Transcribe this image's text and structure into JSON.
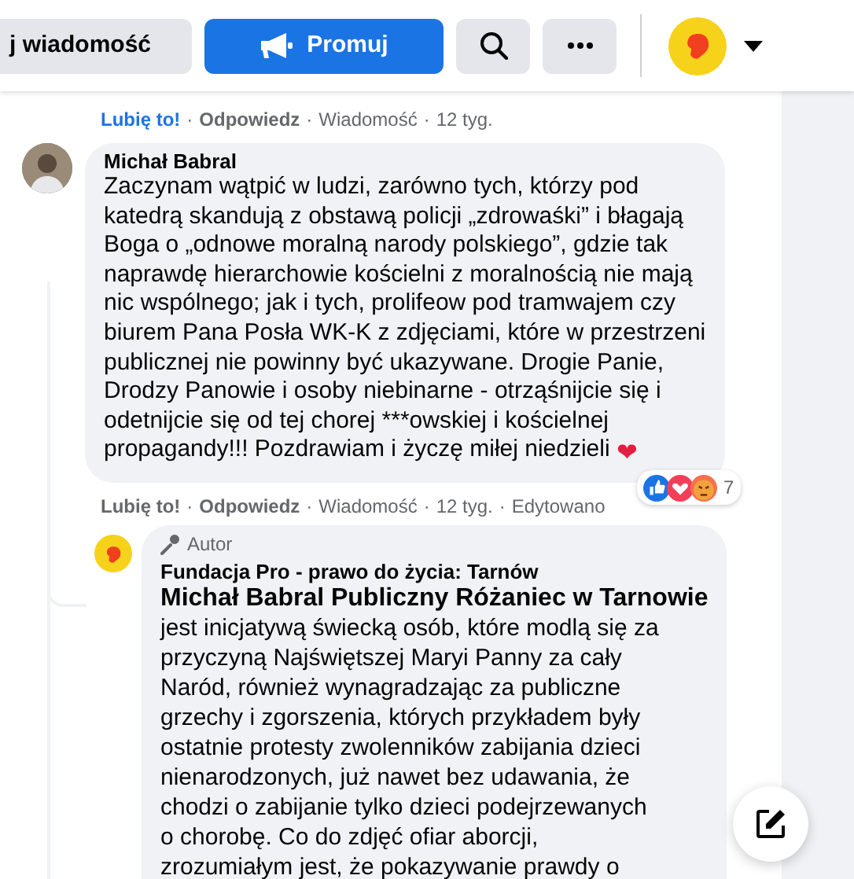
{
  "header": {
    "message_button": "j wiadomość",
    "promote_button": "Promuj"
  },
  "previous_actions": {
    "liked": true,
    "separator": "·",
    "items": [
      {
        "kind": "like",
        "text": "Lubię to!"
      },
      {
        "kind": "reply",
        "text": "Odpowiedz"
      },
      {
        "kind": "meta",
        "text": "Wiadomość"
      },
      {
        "kind": "meta",
        "text": "12 tyg."
      }
    ]
  },
  "comment": {
    "author": "Michał Babral",
    "lines": [
      "Zaczynam wątpić w ludzi, zarówno tych, którzy pod",
      "katedrą skandują z obstawą policji „zdrowaśki” i błagają",
      "Boga o „odnowe moralną narody polskiego”, gdzie tak",
      "naprawdę hierarchowie kościelni z moralnością nie mają",
      "nic wspólnego; jak i tych, prolifeow pod tramwajem czy",
      "biurem Pana Posła WK-K z zdjęciami, które w przestrzeni",
      "publicznej nie powinny być ukazywane. Drogie Panie,",
      "Drodzy Panowie i osoby niebinarne - otrząśnijcie się i",
      "odetnijcie się od tej chorej ***owskiej i kościelnej",
      "propagandy!!! Pozdrawiam i życzę miłej niedzieli"
    ],
    "emoji": "❤",
    "reactions": {
      "types": [
        {
          "kind": "like"
        },
        {
          "kind": "love"
        },
        {
          "kind": "angry"
        }
      ],
      "count": "7"
    },
    "actions": {
      "liked": false,
      "separator": "·",
      "items": [
        {
          "kind": "like",
          "text": "Lubię to!"
        },
        {
          "kind": "reply",
          "text": "Odpowiedz"
        },
        {
          "kind": "meta",
          "text": "Wiadomość"
        },
        {
          "kind": "meta",
          "text": "12 tyg."
        },
        {
          "kind": "meta",
          "text": "Edytowano"
        }
      ]
    }
  },
  "reply": {
    "badge": "Autor",
    "author": "Fundacja Pro - prawo do życia: Tarnów",
    "mention": "Michał Babral Publiczny Różaniec w Tarnowie",
    "lines": [
      "jest inicjatywą świecką osób, które modlą się za",
      "przyczyną Najświętszej Maryi Panny za cały",
      "Naród, również wynagradzając za publiczne",
      "grzechy i zgorszenia, których przykładem były",
      "ostatnie protesty zwolenników zabijania dzieci",
      "nienarodzonych, już nawet bez udawania, że",
      "chodzi o zabijanie tylko dzieci podejrzewanych",
      "o chorobę. Co do zdjęć ofiar aborcji,",
      "zrozumiałym jest, że pokazywanie prawdy o"
    ]
  }
}
